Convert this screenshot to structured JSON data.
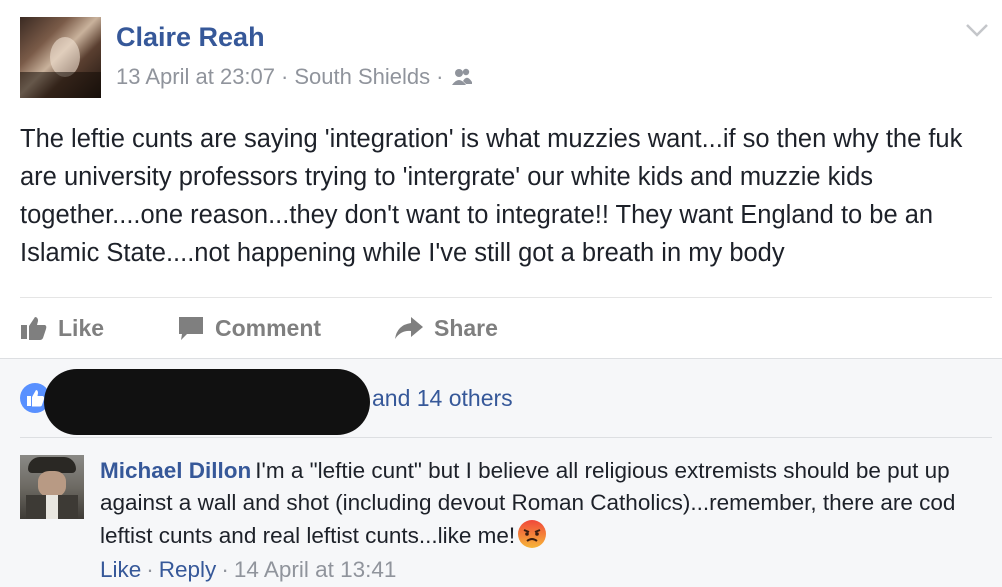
{
  "post": {
    "author": "Claire Reah",
    "timestamp": "13 April at 23:07",
    "location": "South Shields",
    "separator": "·",
    "audience_icon": "friends-icon",
    "menu_icon": "chevron-down-icon",
    "text": "The leftie cunts are saying 'integration' is what muzzies want...if so then why the fuk are university professors trying to 'intergrate' our white kids and muzzie kids together....one reason...they don't want to integrate!! They want England to be an Islamic State....not happening while I've still got a breath in my body"
  },
  "actions": {
    "like": "Like",
    "comment": "Comment",
    "share": "Share"
  },
  "reactions": {
    "others_text": "and 14 others",
    "icon": "thumbs-up-icon"
  },
  "comment": {
    "author": "Michael Dillon",
    "text": "I'm a \"leftie cunt\" but I believe all religious extremists should be put up against a wall and shot (including devout Roman Catholics)...remember, there are cod leftist cunts and real leftist cunts...like me!",
    "emoji": "angry-face-icon",
    "like": "Like",
    "reply": "Reply",
    "timestamp": "14 April at 13:41",
    "separator": "·"
  },
  "colors": {
    "link_blue": "#365899",
    "meta_gray": "#90949c",
    "action_gray": "#7f7f7f",
    "feedback_bg": "#f6f7f9",
    "like_badge": "#5890ff"
  }
}
